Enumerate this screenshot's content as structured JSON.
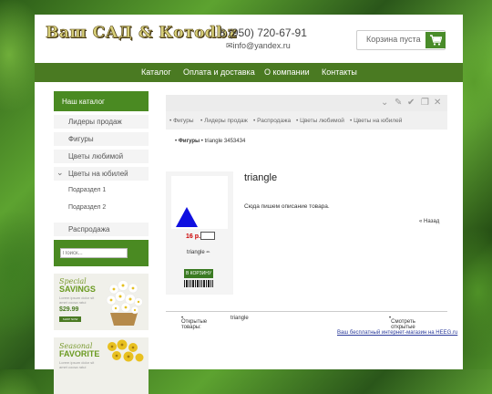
{
  "header": {
    "logo": "Ваш САД & Котоdbz",
    "phone": "8 (950) 720-67-91",
    "email": "info@yandex.ru",
    "cart_label": "Корзина пуста",
    "cart_icon": "shopping-cart-icon"
  },
  "nav": {
    "items": [
      "Каталог",
      "Оплата и доставка",
      "О компании",
      "Контакты"
    ]
  },
  "sidebar": {
    "header": "Наш каталог",
    "items": [
      "Лидеры продаж",
      "Фигуры",
      "Цветы любимой",
      "Цветы на юбилей",
      "Подраздел 1",
      "Подраздел 2",
      "Распродажа"
    ],
    "search_placeholder": "Поиск...",
    "banners": [
      {
        "line1": "Special",
        "line2": "SAVINGS",
        "text": "Lorem ipsum dolor sit amet cocsa ratui",
        "price": "$29.99",
        "button": "SHOP NOW"
      },
      {
        "line1": "Seasonal",
        "line2": "FAVORITE",
        "text": "Lorem ipsum dolor sit amet cocsa ratui"
      }
    ]
  },
  "content": {
    "toolbar_icons": [
      "chevron-down-icon",
      "edit-icon",
      "check-circle-icon",
      "copy-icon",
      "close-icon"
    ],
    "category_tabs": [
      "Фигуры",
      "Лидеры продаж",
      "Распродажа",
      "Цветы любимой",
      "Цветы на юбилей"
    ],
    "breadcrumb": {
      "parent": "Фигуры",
      "current": "triangle 3453434"
    },
    "product": {
      "title": "triangle",
      "description": "Сюда пишем описание товара.",
      "price": "16 р.",
      "name": "triangle",
      "buy_label": "В КОРЗИНУ",
      "back_label": "Назад"
    },
    "opened": {
      "label": "Открытые товары:",
      "item": "triangle",
      "view_all": "Смотреть открытые"
    }
  },
  "footer": {
    "link": "Ваш бесплатный интернет-магазин на HEEG.ru"
  }
}
